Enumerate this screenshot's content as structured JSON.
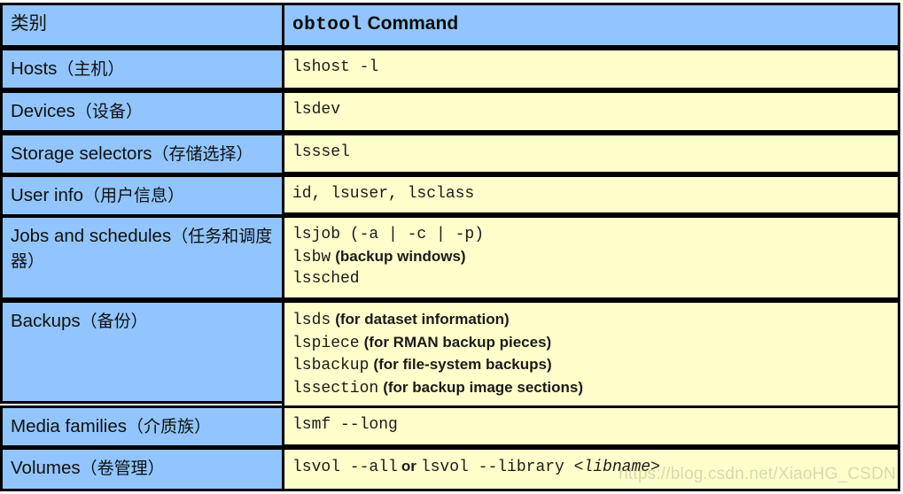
{
  "table": {
    "header": {
      "category_label": "类别",
      "command_label_mono": "obtool",
      "command_label_sans": "Command"
    },
    "colors": {
      "category_bg": "#92C5FE",
      "command_bg": "#FFFFCC",
      "border": "#000000",
      "text": "#111111"
    },
    "rows": [
      {
        "category_en": "Hosts",
        "category_cn": "（主机）",
        "commands": [
          {
            "cmd": "lshost -l",
            "note": ""
          }
        ]
      },
      {
        "category_en": "Devices",
        "category_cn": "（设备）",
        "commands": [
          {
            "cmd": "lsdev",
            "note": ""
          }
        ]
      },
      {
        "category_en": "Storage selectors",
        "category_cn": "（存储选择）",
        "commands": [
          {
            "cmd": "lsssel",
            "note": ""
          }
        ]
      },
      {
        "category_en": "User info",
        "category_cn": "（用户信息）",
        "commands": [
          {
            "cmd": "id, lsuser, lsclass",
            "note": ""
          }
        ]
      },
      {
        "category_en": "Jobs and schedules",
        "category_cn": "（任务和调度器）",
        "commands": [
          {
            "cmd": "lsjob (-a | -c | -p)",
            "note": ""
          },
          {
            "cmd": "lsbw",
            "note": "(backup windows)"
          },
          {
            "cmd": "lssched",
            "note": ""
          }
        ]
      },
      {
        "category_en": "Backups",
        "category_cn": "（备份）",
        "commands": [
          {
            "cmd": "lsds",
            "note": "(for dataset information)"
          },
          {
            "cmd": "lspiece",
            "note": "(for RMAN backup pieces)"
          },
          {
            "cmd": "lsbackup",
            "note": "(for file-system backups)"
          },
          {
            "cmd": "lssection",
            "note": "(for backup image sections)"
          }
        ]
      },
      {
        "category_en": "Media families",
        "category_cn": "（介质族）",
        "commands": [
          {
            "cmd": "lsmf --long",
            "note": ""
          }
        ]
      },
      {
        "category_en": "Volumes",
        "category_cn": "（卷管理）",
        "commands": [
          {
            "cmd": "lsvol --all",
            "keyword": "or",
            "cmd2": "lsvol --library ",
            "variable": "<libname>",
            "note": ""
          }
        ]
      }
    ]
  },
  "watermark": "https://blog.csdn.net/XiaoHG_CSDN"
}
